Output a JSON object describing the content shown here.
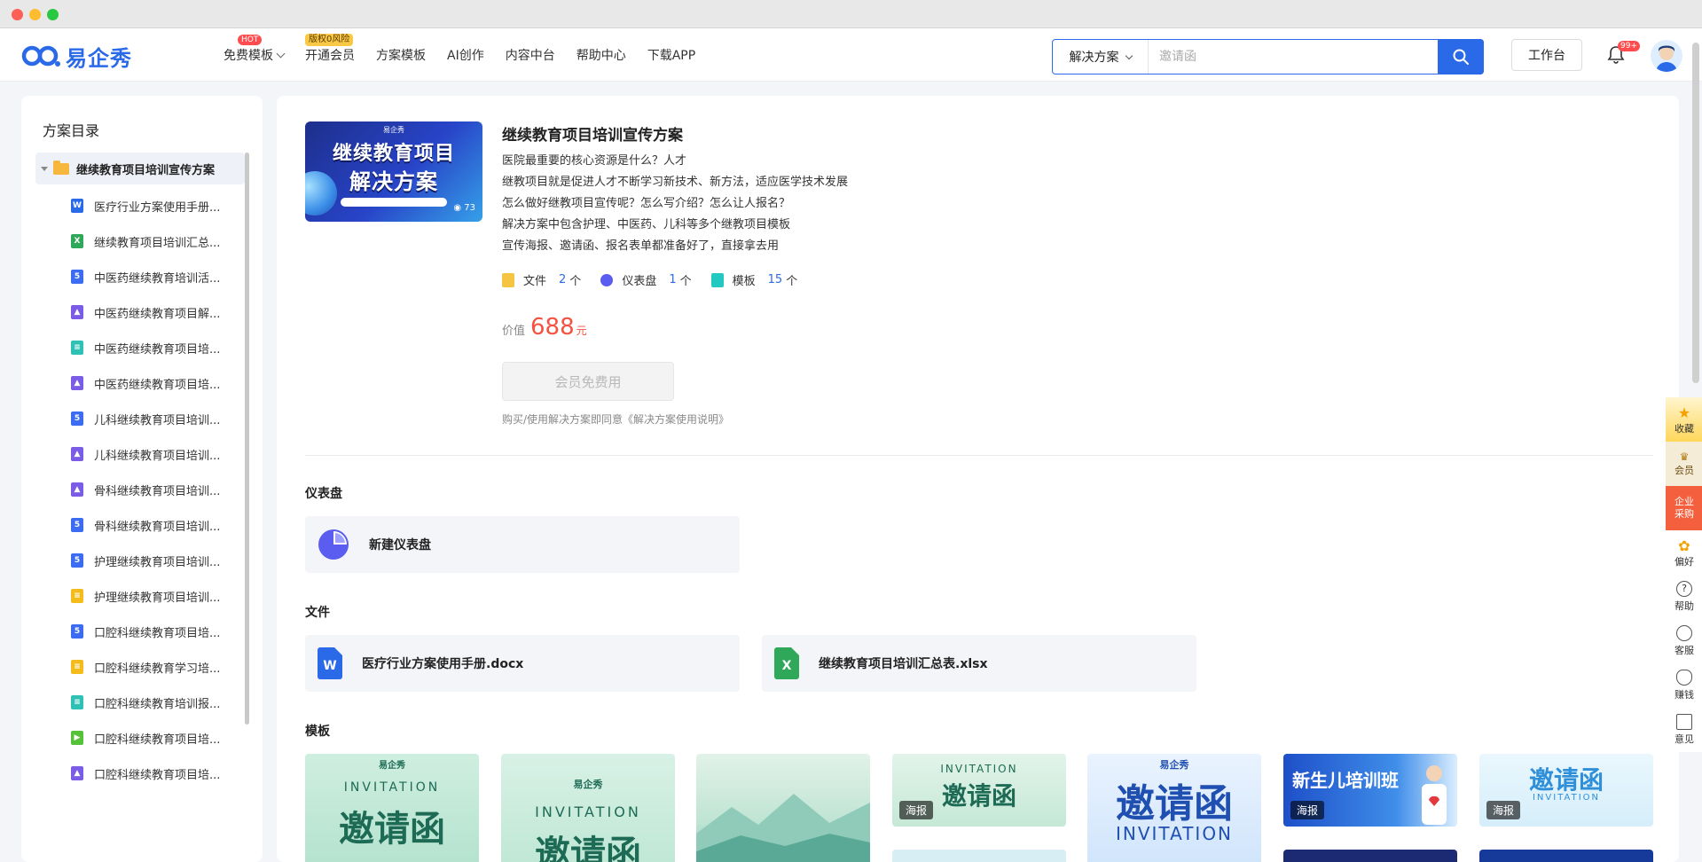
{
  "brand": {
    "name": "易企秀",
    "accent": "#2a6ae8"
  },
  "nav": {
    "items": [
      {
        "label": "免费模板",
        "badge": "HOT",
        "has_dropdown": true
      },
      {
        "label": "开通会员",
        "badge": "版权0风险"
      },
      {
        "label": "方案模板"
      },
      {
        "label": "AI创作"
      },
      {
        "label": "内容中台"
      },
      {
        "label": "帮助中心"
      },
      {
        "label": "下载APP"
      }
    ]
  },
  "search": {
    "scope": "解决方案",
    "placeholder": "邀请函"
  },
  "header": {
    "workbench_label": "工作台",
    "notification_count": "99+"
  },
  "sidebar": {
    "title": "方案目录",
    "root": "继续教育项目培训宣传方案",
    "items": [
      {
        "label": "医疗行业方案使用手册...",
        "icon": "word-file-icon",
        "glyph": "W",
        "type": "word"
      },
      {
        "label": "继续教育项目培训汇总...",
        "icon": "excel-file-icon",
        "glyph": "X",
        "type": "excel"
      },
      {
        "label": "中医药继续教育培训活...",
        "icon": "h5-file-icon",
        "glyph": "5",
        "type": "html"
      },
      {
        "label": "中医药继续教育项目解...",
        "icon": "image-file-icon",
        "glyph": "▲",
        "type": "img"
      },
      {
        "label": "中医药继续教育项目培...",
        "icon": "doc-file-icon",
        "glyph": "≡",
        "type": "doc"
      },
      {
        "label": "中医药继续教育项目培...",
        "icon": "image-file-icon",
        "glyph": "▲",
        "type": "img"
      },
      {
        "label": "儿科继续教育项目培训...",
        "icon": "h5-file-icon",
        "glyph": "5",
        "type": "html"
      },
      {
        "label": "儿科继续教育项目培训...",
        "icon": "image-file-icon",
        "glyph": "▲",
        "type": "img"
      },
      {
        "label": "骨科继续教育项目培训...",
        "icon": "image-file-icon",
        "glyph": "▲",
        "type": "img"
      },
      {
        "label": "骨科继续教育项目培训...",
        "icon": "h5-file-icon",
        "glyph": "5",
        "type": "html"
      },
      {
        "label": "护理继续教育项目培训...",
        "icon": "h5-file-icon",
        "glyph": "5",
        "type": "html"
      },
      {
        "label": "护理继续教育项目培训...",
        "icon": "form-file-icon",
        "glyph": "≡",
        "type": "yellow"
      },
      {
        "label": "口腔科继续教育项目培...",
        "icon": "h5-file-icon",
        "glyph": "5",
        "type": "html"
      },
      {
        "label": "口腔科继续教育学习培...",
        "icon": "form-file-icon",
        "glyph": "≡",
        "type": "yellow"
      },
      {
        "label": "口腔科继续教育培训报...",
        "icon": "doc-file-icon",
        "glyph": "≡",
        "type": "doc"
      },
      {
        "label": "口腔科继续教育项目培...",
        "icon": "video-file-icon",
        "glyph": "▶",
        "type": "video"
      },
      {
        "label": "口腔科继续教育项目培...",
        "icon": "image-file-icon",
        "glyph": "▲",
        "type": "img"
      }
    ]
  },
  "solution": {
    "cover": {
      "brand": "易企秀",
      "line1": "继续教育项目",
      "line2": "解决方案",
      "views": "73"
    },
    "title": "继续教育项目培训宣传方案",
    "desc": [
      "医院最重要的核心资源是什么？人才",
      "继教项目就是促进人才不断学习新技术、新方法，适应医学技术发展",
      "怎么做好继教项目宣传呢？怎么写介绍？怎么让人报名？",
      "解决方案中包含护理、中医药、儿科等多个继教项目模板",
      "宣传海报、邀请函、报名表单都准备好了，直接拿去用"
    ],
    "stats": [
      {
        "label": "文件",
        "count": "2",
        "unit": "个"
      },
      {
        "label": "仪表盘",
        "count": "1",
        "unit": "个"
      },
      {
        "label": "模板",
        "count": "15",
        "unit": "个"
      }
    ],
    "price_label": "价值",
    "price": "688",
    "price_unit": "元",
    "button": "会员免费用",
    "agreement": "购买/使用解决方案即同意《解决方案使用说明》"
  },
  "sections": {
    "dashboard": {
      "title": "仪表盘",
      "items": [
        "新建仪表盘"
      ]
    },
    "files": {
      "title": "文件",
      "items": [
        "医疗行业方案使用手册.docx",
        "继续教育项目培训汇总表.xlsx"
      ]
    },
    "templates": {
      "title": "模板",
      "tag": "海报",
      "items": [
        {
          "text": "邀请函",
          "sub": "INVITATION"
        },
        {
          "text": "邀请函",
          "sub": "INVITATION"
        },
        {
          "text": ""
        },
        {
          "text": "邀请函",
          "sub": "INVITATION"
        },
        {
          "text": "邀请函",
          "sub": "INVITATION"
        },
        {
          "text": "新生儿培训班"
        },
        {
          "text": "邀请函",
          "sub": "INVITATION"
        }
      ]
    }
  },
  "rightbar": [
    "收藏",
    "会员",
    "企业采购",
    "偏好",
    "帮助",
    "客服",
    "赚钱",
    "意见"
  ]
}
